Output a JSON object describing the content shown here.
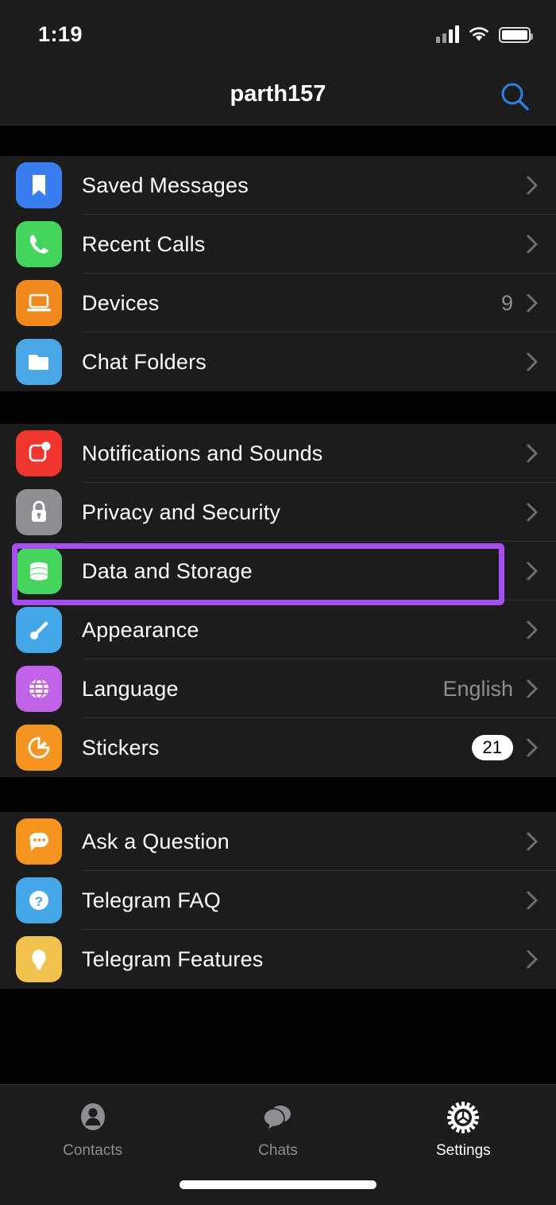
{
  "status_bar": {
    "time": "1:19",
    "cellular_icon": "cellular-bars-icon",
    "wifi_icon": "wifi-icon",
    "battery_icon": "battery-icon"
  },
  "nav": {
    "title": "parth157",
    "search_icon": "search-icon",
    "search_color": "#2f7fe0"
  },
  "sections": [
    {
      "rows": [
        {
          "label": "Saved Messages",
          "icon": "bookmark-icon",
          "color": "#3a7df0",
          "value": ""
        },
        {
          "label": "Recent Calls",
          "icon": "phone-icon",
          "color": "#45d55e",
          "value": ""
        },
        {
          "label": "Devices",
          "icon": "laptop-icon",
          "color": "#f08a1e",
          "value": "9"
        },
        {
          "label": "Chat Folders",
          "icon": "folder-icon",
          "color": "#4aa8e8",
          "value": ""
        }
      ]
    },
    {
      "rows": [
        {
          "label": "Notifications and Sounds",
          "icon": "notification-bell-icon",
          "color": "#f0342e",
          "value": ""
        },
        {
          "label": "Privacy and Security",
          "icon": "lock-icon",
          "color": "#8e8e93",
          "value": ""
        },
        {
          "label": "Data and Storage",
          "icon": "database-icon",
          "color": "#45d55e",
          "value": ""
        },
        {
          "label": "Appearance",
          "icon": "paintbrush-icon",
          "color": "#43a7e8",
          "value": ""
        },
        {
          "label": "Language",
          "icon": "globe-icon",
          "color": "#c262e8",
          "value": "English"
        },
        {
          "label": "Stickers",
          "icon": "sticker-icon",
          "color": "#f59420",
          "badge": "21"
        }
      ]
    },
    {
      "rows": [
        {
          "label": "Ask a Question",
          "icon": "chat-bubble-icon",
          "color": "#f59420",
          "value": ""
        },
        {
          "label": "Telegram FAQ",
          "icon": "question-mark-icon",
          "color": "#43a7e8",
          "value": ""
        },
        {
          "label": "Telegram Features",
          "icon": "lightbulb-icon",
          "color": "#f2c24e",
          "value": ""
        }
      ]
    }
  ],
  "highlight": {
    "target_label": "Data and Storage",
    "color": "#a74ef0"
  },
  "tab_bar": {
    "tabs": [
      {
        "label": "Contacts",
        "icon": "person-icon",
        "active": false
      },
      {
        "label": "Chats",
        "icon": "chats-icon",
        "active": false
      },
      {
        "label": "Settings",
        "icon": "gear-icon",
        "active": true
      }
    ]
  }
}
